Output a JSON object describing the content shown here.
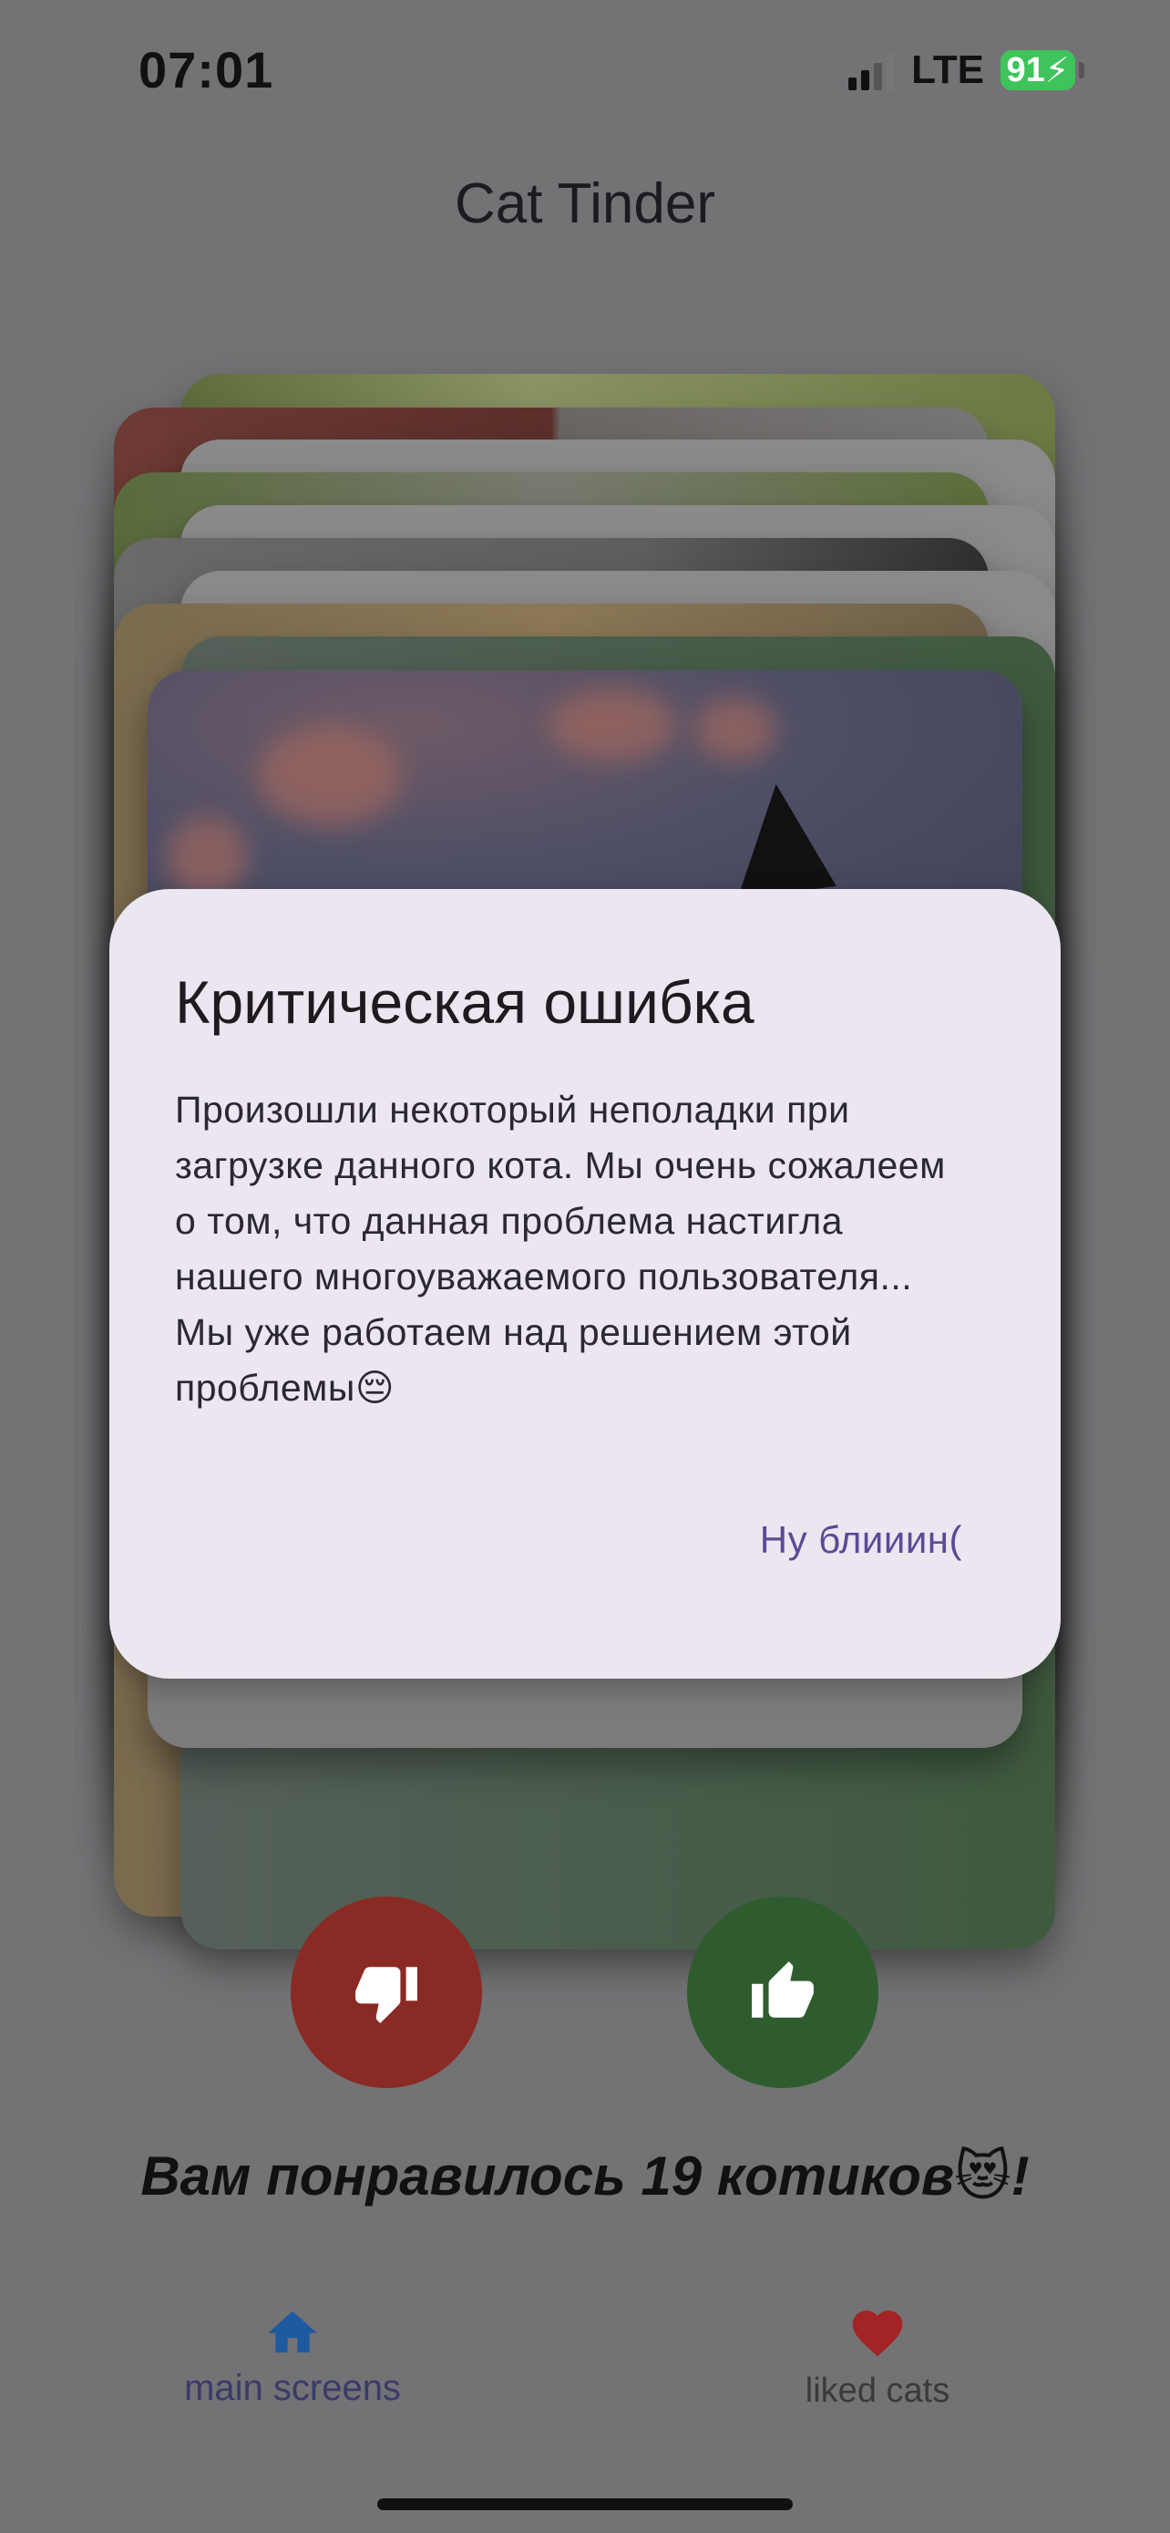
{
  "status_bar": {
    "time": "07:01",
    "network": "LTE",
    "battery": "91"
  },
  "app": {
    "title": "Cat Tinder"
  },
  "dialog": {
    "title": "Критическая ошибка",
    "message": "Произошли некоторый неполадки при загрузке данного кота. Мы очень сожалеем о том, что данная проблема настигла нашего многоуважаемого пользователя... Мы уже работаем над решением этой проблемы😔",
    "action_label": "Ну блииин("
  },
  "actions": {
    "dislike_icon": "thumbs-down-icon",
    "like_icon": "thumbs-up-icon"
  },
  "liked_message": "Вам понравилось 19 котиков😻!",
  "bottom_nav": {
    "items": [
      {
        "label": "main screens",
        "icon": "home-icon",
        "color": "#1e5aa0"
      },
      {
        "label": "liked cats",
        "icon": "heart-icon",
        "color": "#a32424"
      }
    ]
  },
  "colors": {
    "dislike": "#8a2a24",
    "like": "#2e5c2e",
    "dialog_bg": "#ece6f0",
    "accent": "#5b4a96"
  }
}
